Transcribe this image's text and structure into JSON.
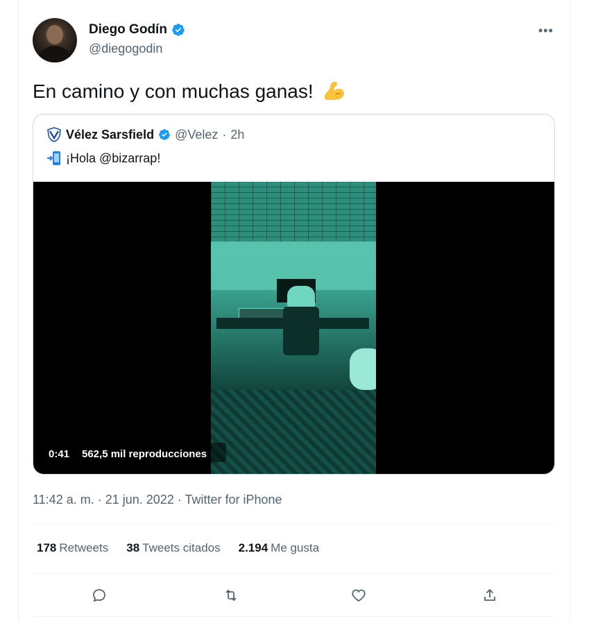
{
  "author": {
    "name": "Diego Godín",
    "handle": "@diegogodin",
    "verified": true,
    "avatar_icon": "user-avatar"
  },
  "more_label": "•••",
  "tweet": {
    "text": "En camino y con muchas ganas!",
    "emoji": "flexed-biceps-emoji"
  },
  "quoted": {
    "name": "Vélez Sarsfield",
    "handle": "@Velez",
    "separator": "·",
    "time": "2h",
    "text": "¡Hola @bizarrap!",
    "text_emoji": "mobile-phone-arrow-emoji",
    "logo_icon": "velez-shield-icon",
    "video": {
      "duration": "0:41",
      "views": "562,5 mil reproducciones"
    }
  },
  "meta": "11:42 a. m. · 21 jun. 2022 · Twitter for iPhone",
  "stats": {
    "retweets_count": "178",
    "retweets_label": "Retweets",
    "quotes_count": "38",
    "quotes_label": "Tweets citados",
    "likes_count": "2.194",
    "likes_label": "Me gusta"
  },
  "actions": [
    "reply-icon",
    "retweet-icon",
    "like-icon",
    "share-icon"
  ],
  "colors": {
    "verified": "#1d9bf0",
    "secondary_text": "#536471",
    "border": "#cfd9de",
    "video_tint": "#3da491"
  }
}
